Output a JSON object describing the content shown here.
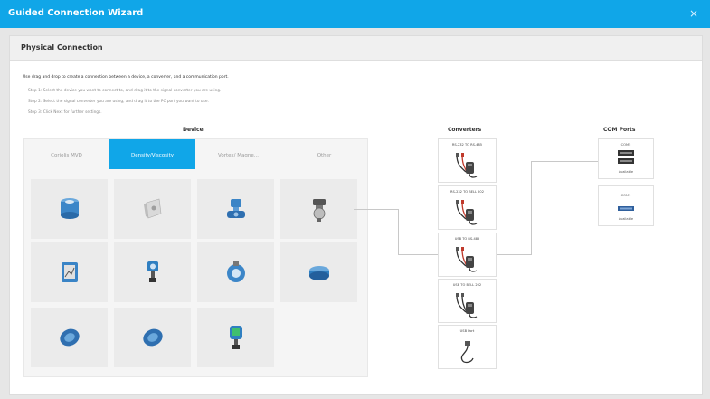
{
  "window": {
    "title": "Guided Connection Wizard",
    "close_icon": "×"
  },
  "section": {
    "title": "Physical Connection"
  },
  "instructions": {
    "intro": "Use drag and drop to create a connection between a device, a converter, and a communication port.",
    "steps": [
      "Step 1: Select the device you want to connect to, and drag it to the signal converter you are using.",
      "Step 2: Select the signal converter you are using, and drag it to the PC port you want to use.",
      "Step 3: Click Next for further settings."
    ]
  },
  "device": {
    "heading": "Device",
    "tabs": [
      "Coriolis MVD",
      "Density/Viscosity",
      "Vortex/ Magne...",
      "Other"
    ],
    "active_tab": 1
  },
  "converters": {
    "heading": "Converters",
    "items": [
      "RS-232 TO RS-485",
      "RS-232 TO BELL 202",
      "USB TO RS-485",
      "USB TO BELL 202",
      "USB Port"
    ]
  },
  "com_ports": {
    "heading": "COM Ports",
    "items": [
      {
        "name": "COM5",
        "status": "Available"
      },
      {
        "name": "COM1",
        "status": "Available"
      }
    ]
  },
  "colors": {
    "accent": "#10a6e8",
    "device_blue": "#2f7fc1"
  }
}
